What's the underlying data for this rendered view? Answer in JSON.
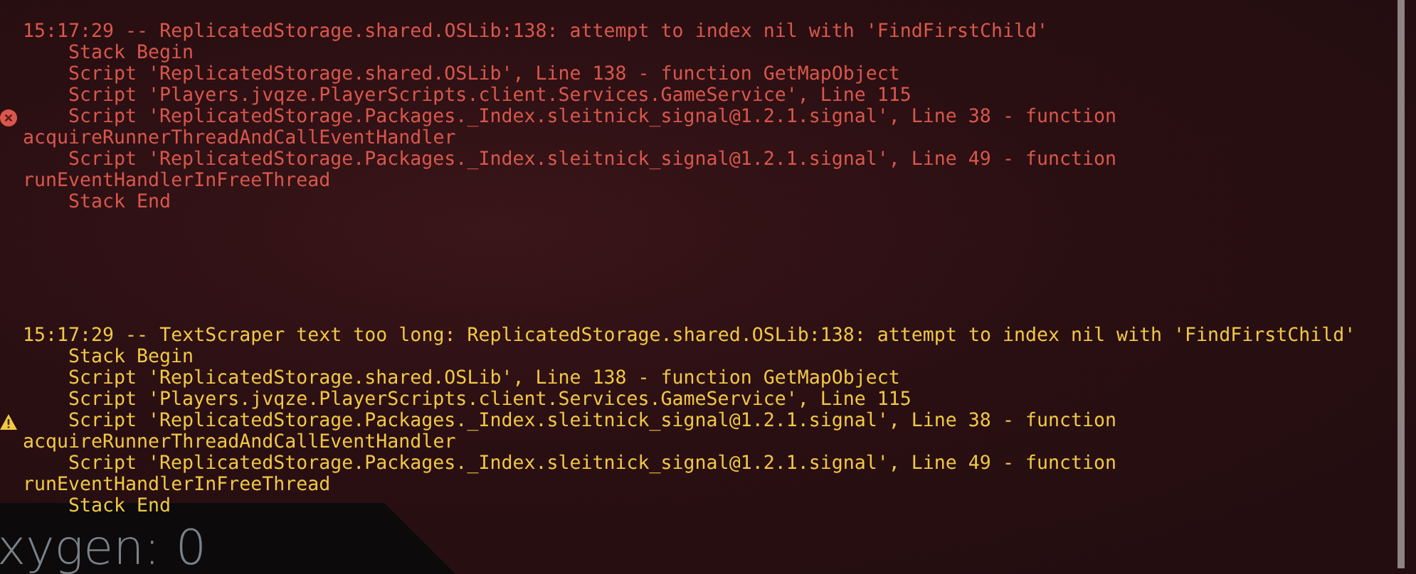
{
  "messages": [
    {
      "kind": "error",
      "lines": [
        {
          "kind": "head",
          "text": "15:17:29 -- ReplicatedStorage.shared.OSLib:138: attempt to index nil with 'FindFirstChild'"
        },
        {
          "kind": "frame",
          "text": "Stack Begin"
        },
        {
          "kind": "frame",
          "text": "Script 'ReplicatedStorage.shared.OSLib', Line 138 - function GetMapObject"
        },
        {
          "kind": "frame",
          "text": "Script 'Players.jvqze.PlayerScripts.client.Services.GameService', Line 115"
        },
        {
          "kind": "frame",
          "text": "Script 'ReplicatedStorage.Packages._Index.sleitnick_signal@1.2.1.signal', Line 38 - function"
        },
        {
          "kind": "wrap",
          "text": "acquireRunnerThreadAndCallEventHandler"
        },
        {
          "kind": "frame",
          "text": "Script 'ReplicatedStorage.Packages._Index.sleitnick_signal@1.2.1.signal', Line 49 - function"
        },
        {
          "kind": "wrap",
          "text": "runEventHandlerInFreeThread"
        },
        {
          "kind": "frame",
          "text": "Stack End"
        }
      ]
    },
    {
      "kind": "warning",
      "lines": [
        {
          "kind": "head",
          "text": "15:17:29 -- TextScraper text too long: ReplicatedStorage.shared.OSLib:138: attempt to index nil with 'FindFirstChild'"
        },
        {
          "kind": "frame",
          "text": "Stack Begin"
        },
        {
          "kind": "frame",
          "text": "Script 'ReplicatedStorage.shared.OSLib', Line 138 - function GetMapObject"
        },
        {
          "kind": "frame",
          "text": "Script 'Players.jvqze.PlayerScripts.client.Services.GameService', Line 115"
        },
        {
          "kind": "frame",
          "text": "Script 'ReplicatedStorage.Packages._Index.sleitnick_signal@1.2.1.signal', Line 38 - function"
        },
        {
          "kind": "wrap",
          "text": "acquireRunnerThreadAndCallEventHandler"
        },
        {
          "kind": "frame",
          "text": "Script 'ReplicatedStorage.Packages._Index.sleitnick_signal@1.2.1.signal', Line 49 - function"
        },
        {
          "kind": "wrap",
          "text": "runEventHandlerInFreeThread"
        },
        {
          "kind": "frame",
          "text": "Stack End"
        }
      ]
    }
  ],
  "hud": {
    "oxygen": "xygen: 0"
  }
}
